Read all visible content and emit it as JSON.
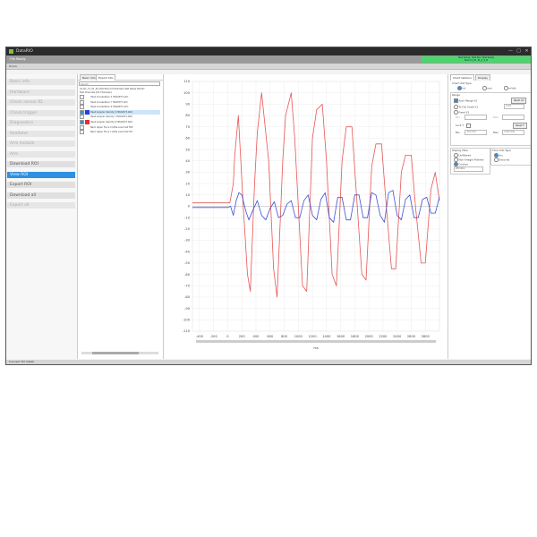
{
  "window": {
    "title": "DataRIO",
    "minimize": "—",
    "maximize": "□",
    "close": "✕"
  },
  "status": {
    "file": "File Ready",
    "green_line1": "Test Setup: Test Run Test Setup",
    "green_line2": "Test 01_01_M_A_S_R"
  },
  "toolbar": {
    "label": "Home"
  },
  "nav": {
    "items": [
      {
        "label": "Basic info",
        "state": "disabled"
      },
      {
        "label": "Hardware",
        "state": "disabled"
      },
      {
        "label": "Check sensor ID",
        "state": "disabled"
      },
      {
        "label": "Check trigger",
        "state": "disabled"
      },
      {
        "label": "Diagnostics",
        "state": "disabled"
      },
      {
        "label": "Realtime",
        "state": "disabled"
      },
      {
        "label": "Arm module",
        "state": "disabled"
      },
      {
        "label": "Arm",
        "state": "disabled"
      },
      {
        "label": "Download ROI",
        "state": "enabled"
      },
      {
        "label": "View ROI",
        "state": "active"
      },
      {
        "label": "Export ROI",
        "state": "enabled"
      },
      {
        "label": "Download all",
        "state": "enabled"
      },
      {
        "label": "Export all",
        "state": "disabled"
      }
    ]
  },
  "tree": {
    "tabs": [
      "Basic Info",
      "Export Info"
    ],
    "search_placeholder": "Search",
    "root_line1": "01_R1_T1_01_R1_ROI Period 0 Example Test Setup ROI R7",
    "root_line2": "Test Channels [16 Channels]",
    "channels": [
      {
        "label": "Head Acceleration X HDAXR73 ACC",
        "checked": false,
        "color": null,
        "selected": false
      },
      {
        "label": "Head Acceleration Y HDAYR73 ACC",
        "checked": false,
        "color": null,
        "selected": false
      },
      {
        "label": "Head Acceleration Z HDAZR73 ACC",
        "checked": false,
        "color": null,
        "selected": false
      },
      {
        "label": "Head Angular Velocity X HDAVR73 ARO",
        "checked": true,
        "color": "#2a3fd6",
        "selected": true
      },
      {
        "label": "Head Angular Velocity Y HDAVR73 ARO",
        "checked": false,
        "color": null,
        "selected": false
      },
      {
        "label": "Head Angular Velocity Z HDAVR73 ARO",
        "checked": true,
        "color": "#e03030",
        "selected": false
      },
      {
        "label": "Neck Upper Force X Little Load Cell FOX",
        "checked": false,
        "color": null,
        "selected": false
      },
      {
        "label": "Neck Upper Force Y Little Load Cell FOY",
        "checked": false,
        "color": null,
        "selected": false
      }
    ]
  },
  "right": {
    "tabs": [
      "Chart Options",
      "Display"
    ],
    "unit_type_title": "Chart Unit Type",
    "unit_types": [
      {
        "label": "Int",
        "on": true
      },
      {
        "label": "mm",
        "on": false
      },
      {
        "label": "mVolt",
        "on": false
      }
    ],
    "range_title": "Range",
    "auto_range": "Auto Range X1",
    "reset_all": "Reset All",
    "to_full_scale": "To Full Scale X1",
    "full_scale_value": "1000",
    "fixed_x": "Fixed X1",
    "min_label": "Min",
    "max_label": "Max",
    "lock_t": "Lock T",
    "reset_t": "Reset T",
    "t_min_label": "Min",
    "t_min_value": "-500.000",
    "t_max_label": "Max",
    "t_max_value": "3,000.000",
    "display_filter_title": "Display Filter",
    "filters": [
      {
        "label": "Unfiltered",
        "on": false
      },
      {
        "label": "Non-Integer Filtered",
        "on": false
      },
      {
        "label": "Custom",
        "on": true
      }
    ],
    "filter_select": "CFC 60",
    "time_unit_title": "Time Unit Type",
    "time_units": [
      {
        "label": "ms",
        "on": true
      },
      {
        "label": "Seconds",
        "on": false
      }
    ]
  },
  "bottom": {
    "text": "Connect  TCI  Install"
  },
  "chart_data": {
    "type": "line",
    "xlabel": "ms",
    "ylabel": "",
    "xlim": [
      -500,
      3000
    ],
    "ylim": [
      -110,
      110
    ],
    "xticks": [
      -400,
      -200,
      0,
      200,
      400,
      600,
      800,
      1000,
      1200,
      1400,
      1600,
      1800,
      2000,
      2200,
      2400,
      2600,
      2800
    ],
    "yticks": [
      110,
      100,
      90,
      80,
      70,
      60,
      50,
      40,
      30,
      20,
      10,
      0,
      -10,
      -20,
      -30,
      -40,
      -50,
      -60,
      -70,
      -80,
      -90,
      -100,
      -110
    ],
    "grid": true,
    "series": [
      {
        "color": "#e85555",
        "x": [
          -500,
          -300,
          -100,
          0,
          30,
          80,
          100,
          150,
          220,
          280,
          320,
          380,
          420,
          480,
          580,
          650,
          700,
          780,
          820,
          900,
          950,
          1060,
          1120,
          1200,
          1260,
          1340,
          1400,
          1480,
          1540,
          1620,
          1680,
          1760,
          1820,
          1900,
          1960,
          2040,
          2100,
          2180,
          2240,
          2320,
          2380,
          2460,
          2520,
          2600,
          2660,
          2740,
          2800,
          2880,
          2940,
          3000
        ],
        "y": [
          3,
          3,
          3,
          3,
          3,
          20,
          45,
          80,
          0,
          -60,
          -75,
          20,
          65,
          100,
          40,
          -55,
          -80,
          40,
          80,
          100,
          60,
          -70,
          -75,
          60,
          85,
          90,
          40,
          -60,
          -70,
          40,
          70,
          70,
          15,
          -60,
          -65,
          35,
          55,
          55,
          5,
          -55,
          -55,
          30,
          45,
          45,
          0,
          -50,
          -50,
          15,
          30,
          5
        ]
      },
      {
        "color": "#3a4fd6",
        "x": [
          -500,
          -300,
          -100,
          0,
          40,
          80,
          120,
          160,
          200,
          260,
          300,
          360,
          420,
          480,
          540,
          600,
          660,
          720,
          780,
          840,
          900,
          960,
          1020,
          1080,
          1140,
          1200,
          1260,
          1320,
          1380,
          1440,
          1500,
          1560,
          1620,
          1680,
          1740,
          1800,
          1860,
          1920,
          1980,
          2040,
          2100,
          2160,
          2220,
          2280,
          2340,
          2400,
          2460,
          2520,
          2580,
          2640,
          2700,
          2760,
          2820,
          2880,
          2940,
          3000
        ],
        "y": [
          -1,
          -1,
          -1,
          -1,
          0,
          -8,
          5,
          12,
          10,
          -5,
          -12,
          -3,
          5,
          -8,
          -12,
          -2,
          4,
          -10,
          -8,
          2,
          5,
          -10,
          -10,
          5,
          10,
          -8,
          -12,
          6,
          12,
          -10,
          -14,
          8,
          8,
          -12,
          -12,
          10,
          10,
          -10,
          -10,
          12,
          10,
          -8,
          -14,
          12,
          14,
          -8,
          -12,
          6,
          10,
          -10,
          -10,
          6,
          8,
          -6,
          -6,
          8
        ]
      }
    ]
  }
}
